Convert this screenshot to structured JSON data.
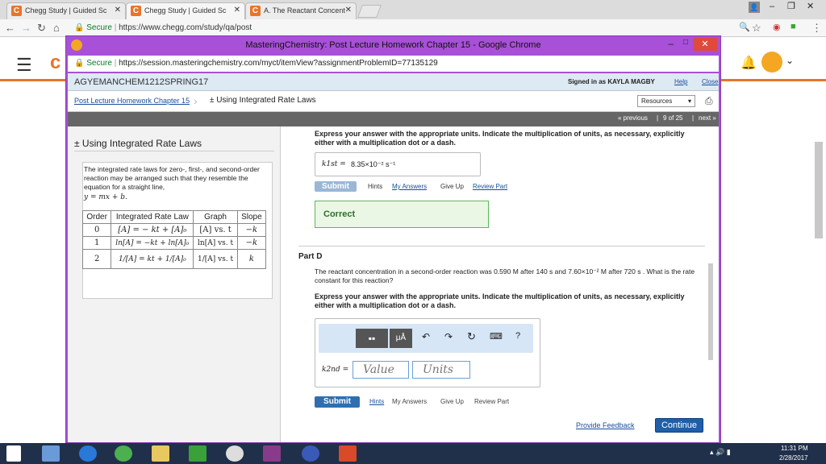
{
  "outer_tabs": [
    {
      "label": "Chegg Study | Guided Sc"
    },
    {
      "label": "Chegg Study | Guided Sc"
    },
    {
      "label": "A. The Reactant Concent"
    }
  ],
  "outer_address": {
    "secure": "Secure",
    "url": "https://www.chegg.com/study/qa/post"
  },
  "popup": {
    "title": "MasteringChemistry: Post Lecture Homework Chapter 15 - Google Chrome",
    "secure": "Secure",
    "url": "https://session.masteringchemistry.com/myct/itemView?assignmentProblemID=77135129"
  },
  "header": {
    "course": "AGYEMANCHEM1212SPRING17",
    "signed_in": "Signed in as KAYLA MAGBY",
    "help": "Help",
    "close": "Close",
    "breadcrumb_link": "Post Lecture Homework Chapter 15",
    "breadcrumb_current": "± Using Integrated Rate Laws",
    "resources": "Resources",
    "previous": "« previous",
    "page_info": "9 of 25",
    "next": "next »"
  },
  "left": {
    "title": "± Using Integrated Rate Laws",
    "description": "The integrated rate laws for zero-, first-, and second-order reaction may be arranged such that they resemble the equation for a straight line,",
    "equation": "y = mx + b.",
    "table": {
      "headers": [
        "Order",
        "Integrated Rate Law",
        "Graph",
        "Slope"
      ],
      "rows": [
        [
          "0",
          "[A] = − kt + [A]₀",
          "[A] vs. t",
          "−k"
        ],
        [
          "1",
          "ln[A] = −kt + ln[A]₀",
          "ln[A] vs. t",
          "−k"
        ],
        [
          "2",
          "1/[A] = kt + 1/[A]₀",
          "1/[A] vs. t",
          "k"
        ]
      ]
    }
  },
  "right": {
    "instruction_top": "Express your answer with the appropriate units. Indicate the multiplication of units, as necessary, explicitly either with a multiplication dot or a dash.",
    "prev_answer_label": "k1st =",
    "prev_answer_value": "8.35×10⁻² s⁻¹",
    "submit": "Submit",
    "hints": "Hints",
    "my_answers": "My Answers",
    "give_up": "Give Up",
    "review_part": "Review Part",
    "correct": "Correct",
    "part_title": "Part D",
    "question": "The reactant concentration in a second-order reaction was 0.590 M after 140 s and 7.60×10⁻² M after 720 s . What is the rate constant for this reaction?",
    "instruction": "Express your answer with the appropriate units. Indicate the multiplication of units, as necessary, explicitly either with a multiplication dot or a dash.",
    "answer_label": "k2nd =",
    "value_placeholder": "Value",
    "units_placeholder": "Units",
    "toolbar_mu": "μÅ",
    "toolbar_help": "?",
    "provide_feedback": "Provide Feedback",
    "continue": "Continue"
  },
  "taskbar": {
    "time": "11:31 PM",
    "date": "2/28/2017"
  },
  "colors": {
    "popup_frame": "#a850d8",
    "submit_blue": "#2f6fb0",
    "correct_green": "#5cb85c",
    "chegg_orange": "#e8742a",
    "taskbar": "#20304a"
  }
}
